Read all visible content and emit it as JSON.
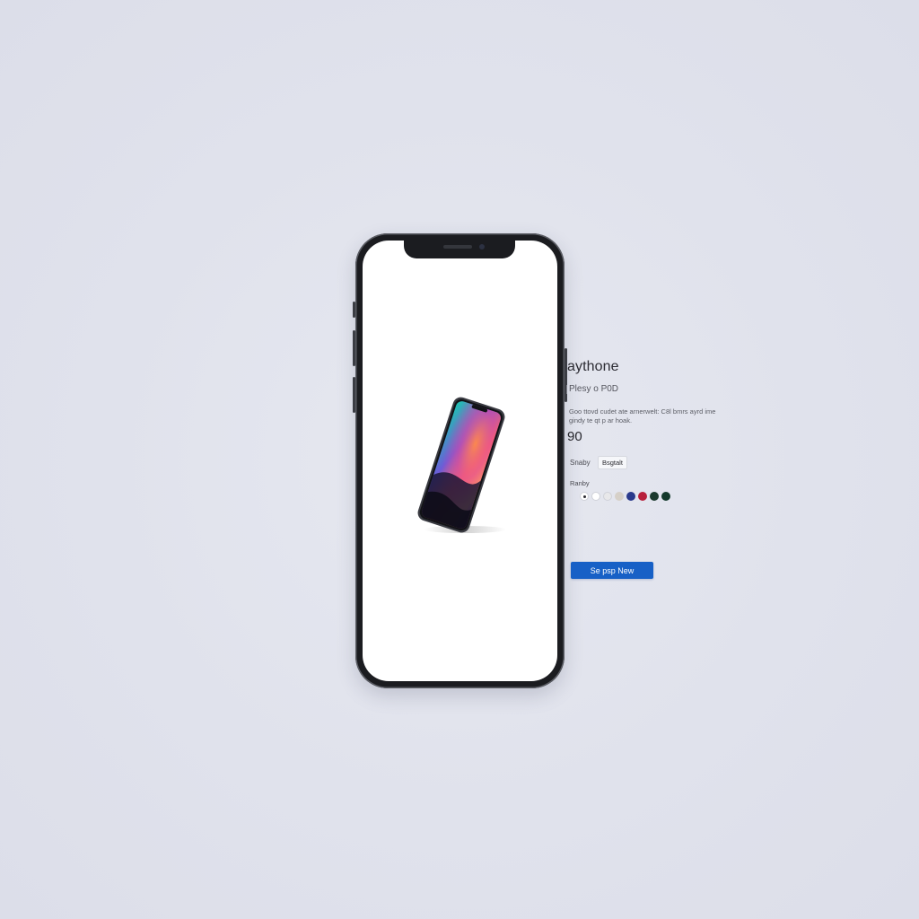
{
  "product": {
    "name": "aythone",
    "model": "Plesy o P0D",
    "description": "Goo ttovd cudet ate arnerwelt: C8l bmrs ayrd ime gindy te qt p ar hoak.",
    "price": "90",
    "storage": {
      "label": "Snaby",
      "selected": "Bsgtalt"
    },
    "color": {
      "label": "Ranby",
      "swatches": [
        {
          "name": "white-selected",
          "hex": "#ffffff",
          "selected": true
        },
        {
          "name": "white",
          "hex": "#ffffff",
          "selected": false
        },
        {
          "name": "silver",
          "hex": "#e8e8ea",
          "selected": false
        },
        {
          "name": "beige",
          "hex": "#d6d0c8",
          "selected": false
        },
        {
          "name": "blue",
          "hex": "#2a3a8c",
          "selected": false
        },
        {
          "name": "red",
          "hex": "#b8203c",
          "selected": false
        },
        {
          "name": "dark-green",
          "hex": "#1c3a2e",
          "selected": false
        },
        {
          "name": "green",
          "hex": "#14392c",
          "selected": false
        }
      ]
    },
    "cta_label": "Se psp New"
  },
  "colors": {
    "accent": "#1760c6",
    "phone_frame": "#1b1c20",
    "page_background": "#e0e2ec"
  },
  "icons": {
    "phone_mockup": "smartphone-frame",
    "product_image": "smartphone-product-render"
  }
}
